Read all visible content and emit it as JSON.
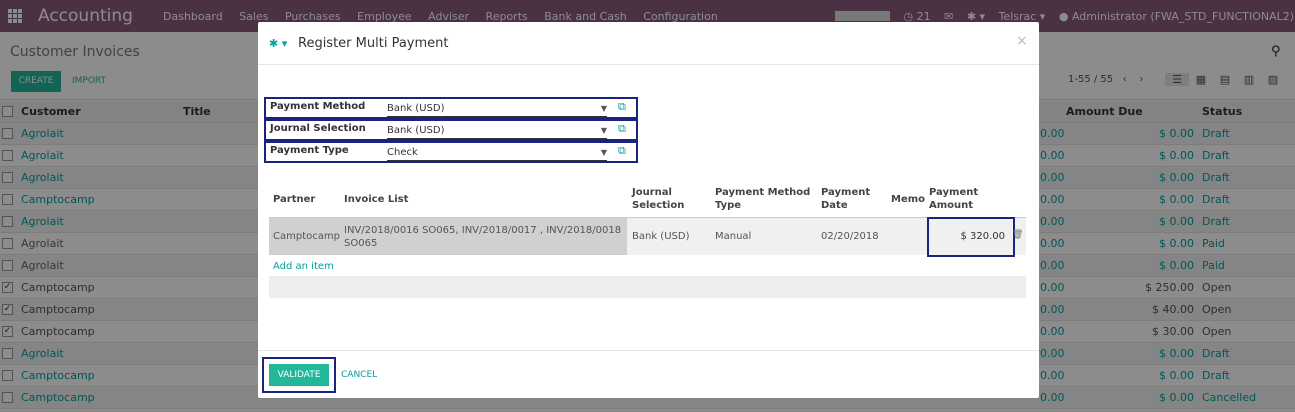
{
  "topbar": {
    "brand": "Accounting",
    "menu": [
      "Dashboard",
      "Sales",
      "Purchases",
      "Employee",
      "Adviser",
      "Reports",
      "Bank and Cash",
      "Configuration"
    ],
    "chat_count": "21",
    "company": "Telsrac",
    "user": "Administrator (FWA_STD_FUNCTIONAL2)"
  },
  "control_panel": {
    "title": "Customer Invoices",
    "create_label": "CREATE",
    "import_label": "IMPORT",
    "pager": "1-55 / 55"
  },
  "list": {
    "headers": {
      "customer": "Customer",
      "title": "Title",
      "amount_due": "Amount Due",
      "status": "Status"
    },
    "rows": [
      {
        "customer": "Agrolait",
        "edge": "0.00",
        "amount": "$ 0.00",
        "status": "Draft",
        "checked": false
      },
      {
        "customer": "Agrolait",
        "edge": "0.00",
        "amount": "$ 0.00",
        "status": "Draft",
        "checked": false
      },
      {
        "customer": "Agrolait",
        "edge": "0.00",
        "amount": "$ 0.00",
        "status": "Draft",
        "checked": false
      },
      {
        "customer": "Camptocamp",
        "edge": "0.00",
        "amount": "$ 0.00",
        "status": "Draft",
        "checked": false
      },
      {
        "customer": "Agrolait",
        "edge": "0.00",
        "amount": "$ 0.00",
        "status": "Draft",
        "checked": false
      },
      {
        "customer": "Agrolait",
        "edge": "0.00",
        "amount": "$ 0.00",
        "status": "Paid",
        "checked": false
      },
      {
        "customer": "Agrolait",
        "edge": "0.00",
        "amount": "$ 0.00",
        "status": "Paid",
        "checked": false
      },
      {
        "customer": "Camptocamp",
        "edge": "0.00",
        "amount": "$ 250.00",
        "status": "Open",
        "checked": true
      },
      {
        "customer": "Camptocamp",
        "edge": "0.00",
        "amount": "$ 40.00",
        "status": "Open",
        "checked": true
      },
      {
        "customer": "Camptocamp",
        "edge": "0.00",
        "amount": "$ 30.00",
        "status": "Open",
        "checked": true
      },
      {
        "customer": "Agrolait",
        "edge": "0.00",
        "amount": "$ 0.00",
        "status": "Draft",
        "checked": false
      },
      {
        "customer": "Camptocamp",
        "edge": "0.00",
        "amount": "$ 0.00",
        "status": "Draft",
        "checked": false
      },
      {
        "customer": "Camptocamp",
        "edge": "0.00",
        "amount": "$ 0.00",
        "status": "Cancelled",
        "checked": false
      }
    ]
  },
  "modal": {
    "title": "Register Multi Payment",
    "fields": [
      {
        "label": "Payment Method",
        "value": "Bank (USD)"
      },
      {
        "label": "Journal Selection",
        "value": "Bank (USD)"
      },
      {
        "label": "Payment Type",
        "value": "Check"
      }
    ],
    "table": {
      "headers": {
        "partner": "Partner",
        "invoice_list": "Invoice List",
        "journal_selection": "Journal Selection",
        "payment_method_type": "Payment Method Type",
        "payment_date": "Payment Date",
        "memo": "Memo",
        "payment_amount": "Payment Amount"
      },
      "row": {
        "partner": "Camptocamp",
        "invoice_list": "INV/2018/0016 SO065, INV/2018/0017 , INV/2018/0018 SO065",
        "journal_selection": "Bank (USD)",
        "payment_method_type": "Manual",
        "payment_date": "02/20/2018",
        "memo": "",
        "payment_amount": "$ 320.00"
      },
      "add_item_label": "Add an item"
    },
    "validate_label": "VALIDATE",
    "cancel_label": "CANCEL"
  }
}
